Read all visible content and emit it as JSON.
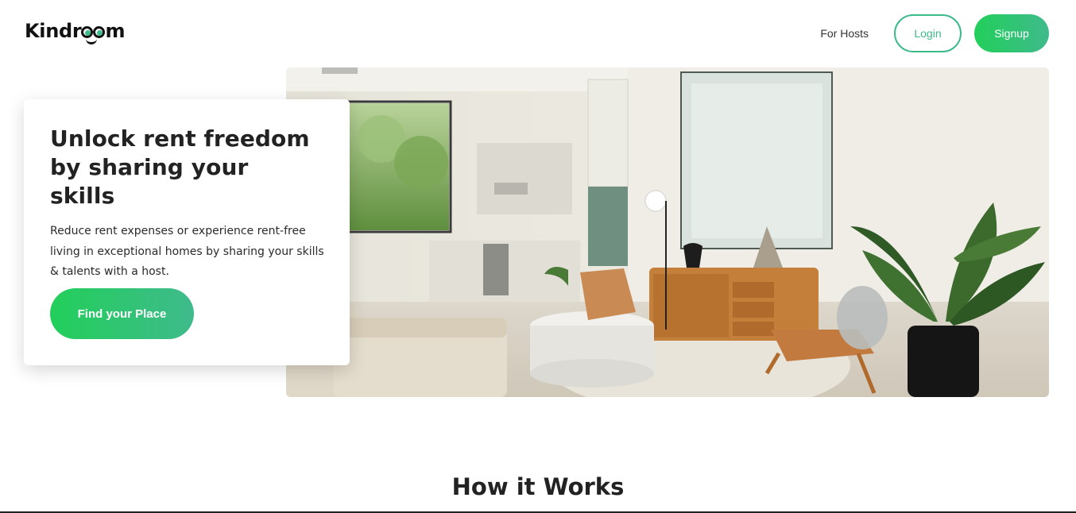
{
  "brand": {
    "pre": "Kindr",
    "post": "m"
  },
  "nav": {
    "for_hosts": "For Hosts",
    "login": "Login",
    "signup": "Signup"
  },
  "hero": {
    "title": "Unlock rent freedom by sharing your skills",
    "description": "Reduce rent expenses or experience rent-free living in exceptional homes by sharing your skills & talents with a host.",
    "cta": "Find your Place"
  },
  "section": {
    "title": "How it Works"
  },
  "colors": {
    "accent_start": "#22cf5a",
    "accent_end": "#3fba8c",
    "accent_text": "#3dba8a"
  }
}
